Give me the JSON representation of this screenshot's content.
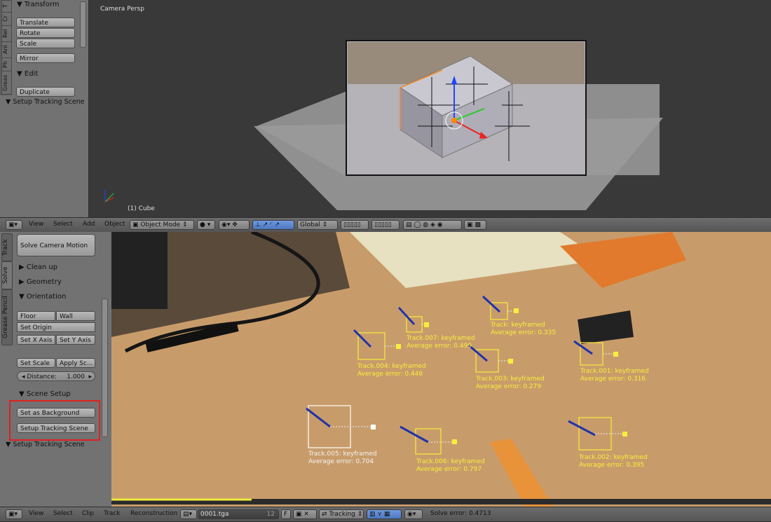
{
  "top_shelf": {
    "tabs": [
      "T",
      "Cr",
      "Rel",
      "Ani",
      "Ph",
      "Greas"
    ],
    "transform_header": "Transform",
    "buttons": [
      "Translate",
      "Rotate",
      "Scale"
    ],
    "mirror": "Mirror",
    "edit_header": "Edit",
    "duplicate": "Duplicate",
    "operator_panel": "Setup Tracking Scene"
  },
  "viewport": {
    "view_label": "Camera Persp",
    "object_label": "(1) Cube"
  },
  "viewport_header": {
    "menus": [
      "View",
      "Select",
      "Add",
      "Object"
    ],
    "mode": "Object Mode",
    "orientation": "Global"
  },
  "clip_sidebar": {
    "tabs": [
      "Track",
      "Solve",
      "Grease Pencil"
    ],
    "solve_button": "Solve Camera Motion",
    "panels": [
      "Clean up",
      "Geometry"
    ],
    "orientation_header": "Orientation",
    "floor": "Floor",
    "wall": "Wall",
    "set_origin": "Set Origin",
    "set_x_axis": "Set X Axis",
    "set_y_axis": "Set Y Axis",
    "set_scale": "Set Scale",
    "apply_scale": "Apply Sc...",
    "distance_label": "Distance:",
    "distance_value": "1.000",
    "scene_setup_header": "Scene Setup",
    "set_as_background": "Set as Background",
    "setup_tracking_scene": "Setup Tracking Scene",
    "operator_panel": "Setup Tracking Scene"
  },
  "tracks": [
    {
      "name": "Track.007: keyframed",
      "error": "Average error: 0.499"
    },
    {
      "name": "Track: keyframed",
      "error": "Average error: 0.335"
    },
    {
      "name": "Track.004: keyframed",
      "error": "Average error: 0.446"
    },
    {
      "name": "Track.003: keyframed",
      "error": "Average error: 0.279"
    },
    {
      "name": "Track.001: keyframed",
      "error": "Average error: 0.316"
    },
    {
      "name": "Track.005: keyframed",
      "error": "Average error: 0.704"
    },
    {
      "name": "Track.006: keyframed",
      "error": "Average error: 0.797"
    },
    {
      "name": "Track.002: keyframed",
      "error": "Average error: 0.395"
    }
  ],
  "clip_header": {
    "menus": [
      "View",
      "Select",
      "Clip",
      "Track",
      "Reconstruction"
    ],
    "clip_name": "0001.tga",
    "users": "12",
    "fake": "F",
    "mode": "Tracking",
    "solve_error": "Solve error: 0.4713"
  },
  "colors": {
    "track_selected": "#f7ee3c",
    "track_active": "#ffffff",
    "highlight_box": "#e02020"
  }
}
